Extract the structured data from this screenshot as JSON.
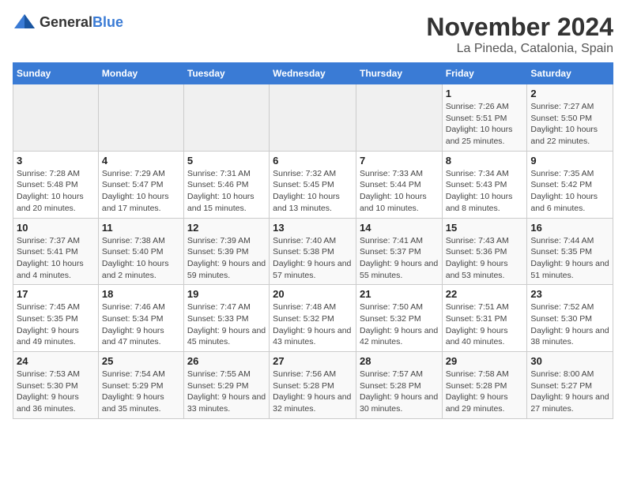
{
  "logo": {
    "text_general": "General",
    "text_blue": "Blue"
  },
  "header": {
    "month": "November 2024",
    "location": "La Pineda, Catalonia, Spain"
  },
  "weekdays": [
    "Sunday",
    "Monday",
    "Tuesday",
    "Wednesday",
    "Thursday",
    "Friday",
    "Saturday"
  ],
  "weeks": [
    [
      {
        "day": "",
        "sunrise": "",
        "sunset": "",
        "daylight": ""
      },
      {
        "day": "",
        "sunrise": "",
        "sunset": "",
        "daylight": ""
      },
      {
        "day": "",
        "sunrise": "",
        "sunset": "",
        "daylight": ""
      },
      {
        "day": "",
        "sunrise": "",
        "sunset": "",
        "daylight": ""
      },
      {
        "day": "",
        "sunrise": "",
        "sunset": "",
        "daylight": ""
      },
      {
        "day": "1",
        "sunrise": "Sunrise: 7:26 AM",
        "sunset": "Sunset: 5:51 PM",
        "daylight": "Daylight: 10 hours and 25 minutes."
      },
      {
        "day": "2",
        "sunrise": "Sunrise: 7:27 AM",
        "sunset": "Sunset: 5:50 PM",
        "daylight": "Daylight: 10 hours and 22 minutes."
      }
    ],
    [
      {
        "day": "3",
        "sunrise": "Sunrise: 7:28 AM",
        "sunset": "Sunset: 5:48 PM",
        "daylight": "Daylight: 10 hours and 20 minutes."
      },
      {
        "day": "4",
        "sunrise": "Sunrise: 7:29 AM",
        "sunset": "Sunset: 5:47 PM",
        "daylight": "Daylight: 10 hours and 17 minutes."
      },
      {
        "day": "5",
        "sunrise": "Sunrise: 7:31 AM",
        "sunset": "Sunset: 5:46 PM",
        "daylight": "Daylight: 10 hours and 15 minutes."
      },
      {
        "day": "6",
        "sunrise": "Sunrise: 7:32 AM",
        "sunset": "Sunset: 5:45 PM",
        "daylight": "Daylight: 10 hours and 13 minutes."
      },
      {
        "day": "7",
        "sunrise": "Sunrise: 7:33 AM",
        "sunset": "Sunset: 5:44 PM",
        "daylight": "Daylight: 10 hours and 10 minutes."
      },
      {
        "day": "8",
        "sunrise": "Sunrise: 7:34 AM",
        "sunset": "Sunset: 5:43 PM",
        "daylight": "Daylight: 10 hours and 8 minutes."
      },
      {
        "day": "9",
        "sunrise": "Sunrise: 7:35 AM",
        "sunset": "Sunset: 5:42 PM",
        "daylight": "Daylight: 10 hours and 6 minutes."
      }
    ],
    [
      {
        "day": "10",
        "sunrise": "Sunrise: 7:37 AM",
        "sunset": "Sunset: 5:41 PM",
        "daylight": "Daylight: 10 hours and 4 minutes."
      },
      {
        "day": "11",
        "sunrise": "Sunrise: 7:38 AM",
        "sunset": "Sunset: 5:40 PM",
        "daylight": "Daylight: 10 hours and 2 minutes."
      },
      {
        "day": "12",
        "sunrise": "Sunrise: 7:39 AM",
        "sunset": "Sunset: 5:39 PM",
        "daylight": "Daylight: 9 hours and 59 minutes."
      },
      {
        "day": "13",
        "sunrise": "Sunrise: 7:40 AM",
        "sunset": "Sunset: 5:38 PM",
        "daylight": "Daylight: 9 hours and 57 minutes."
      },
      {
        "day": "14",
        "sunrise": "Sunrise: 7:41 AM",
        "sunset": "Sunset: 5:37 PM",
        "daylight": "Daylight: 9 hours and 55 minutes."
      },
      {
        "day": "15",
        "sunrise": "Sunrise: 7:43 AM",
        "sunset": "Sunset: 5:36 PM",
        "daylight": "Daylight: 9 hours and 53 minutes."
      },
      {
        "day": "16",
        "sunrise": "Sunrise: 7:44 AM",
        "sunset": "Sunset: 5:35 PM",
        "daylight": "Daylight: 9 hours and 51 minutes."
      }
    ],
    [
      {
        "day": "17",
        "sunrise": "Sunrise: 7:45 AM",
        "sunset": "Sunset: 5:35 PM",
        "daylight": "Daylight: 9 hours and 49 minutes."
      },
      {
        "day": "18",
        "sunrise": "Sunrise: 7:46 AM",
        "sunset": "Sunset: 5:34 PM",
        "daylight": "Daylight: 9 hours and 47 minutes."
      },
      {
        "day": "19",
        "sunrise": "Sunrise: 7:47 AM",
        "sunset": "Sunset: 5:33 PM",
        "daylight": "Daylight: 9 hours and 45 minutes."
      },
      {
        "day": "20",
        "sunrise": "Sunrise: 7:48 AM",
        "sunset": "Sunset: 5:32 PM",
        "daylight": "Daylight: 9 hours and 43 minutes."
      },
      {
        "day": "21",
        "sunrise": "Sunrise: 7:50 AM",
        "sunset": "Sunset: 5:32 PM",
        "daylight": "Daylight: 9 hours and 42 minutes."
      },
      {
        "day": "22",
        "sunrise": "Sunrise: 7:51 AM",
        "sunset": "Sunset: 5:31 PM",
        "daylight": "Daylight: 9 hours and 40 minutes."
      },
      {
        "day": "23",
        "sunrise": "Sunrise: 7:52 AM",
        "sunset": "Sunset: 5:30 PM",
        "daylight": "Daylight: 9 hours and 38 minutes."
      }
    ],
    [
      {
        "day": "24",
        "sunrise": "Sunrise: 7:53 AM",
        "sunset": "Sunset: 5:30 PM",
        "daylight": "Daylight: 9 hours and 36 minutes."
      },
      {
        "day": "25",
        "sunrise": "Sunrise: 7:54 AM",
        "sunset": "Sunset: 5:29 PM",
        "daylight": "Daylight: 9 hours and 35 minutes."
      },
      {
        "day": "26",
        "sunrise": "Sunrise: 7:55 AM",
        "sunset": "Sunset: 5:29 PM",
        "daylight": "Daylight: 9 hours and 33 minutes."
      },
      {
        "day": "27",
        "sunrise": "Sunrise: 7:56 AM",
        "sunset": "Sunset: 5:28 PM",
        "daylight": "Daylight: 9 hours and 32 minutes."
      },
      {
        "day": "28",
        "sunrise": "Sunrise: 7:57 AM",
        "sunset": "Sunset: 5:28 PM",
        "daylight": "Daylight: 9 hours and 30 minutes."
      },
      {
        "day": "29",
        "sunrise": "Sunrise: 7:58 AM",
        "sunset": "Sunset: 5:28 PM",
        "daylight": "Daylight: 9 hours and 29 minutes."
      },
      {
        "day": "30",
        "sunrise": "Sunrise: 8:00 AM",
        "sunset": "Sunset: 5:27 PM",
        "daylight": "Daylight: 9 hours and 27 minutes."
      }
    ]
  ]
}
